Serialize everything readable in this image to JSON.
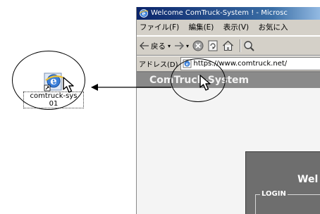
{
  "desktop": {
    "shortcut_label_line1": "comtruck-sys",
    "shortcut_label_line2": "01"
  },
  "browser": {
    "title": "Welcome ComTruck-System ! - Microsc",
    "menu": [
      "ファイル(F)",
      "編集(E)",
      "表示(V)",
      "お気に入"
    ],
    "toolbar": {
      "back_label": "戻る"
    },
    "address": {
      "label": "アドレス(D)",
      "url": "https://www.comtruck.net/"
    },
    "page": {
      "banner_title": "ComTruck-System",
      "welcome_text": "Wel",
      "login_label": "LOGIN"
    }
  },
  "colors": {
    "title_bar": "#0a246a",
    "banner": "#8a8a8a",
    "panel": "#6e6e6e",
    "chrome": "#d4d0c8"
  }
}
